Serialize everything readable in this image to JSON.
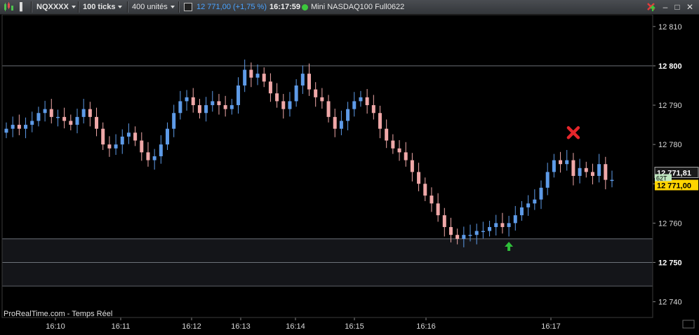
{
  "toolbar": {
    "symbol": "NQXXXX",
    "timeframe": "100 ticks",
    "units": "400 unités",
    "last_price": "12 771,00 (+1,75 %)",
    "time": "16:17:59",
    "instrument": "Mini NASDAQ100 Full0622",
    "status_color": "#3cc83c"
  },
  "watermark": "ProRealTime.com - Temps Réel",
  "price_labels": {
    "current": "12 771,81",
    "last": "12 771,00",
    "tick_badge": "62T"
  },
  "colors": {
    "up": "#5e9be8",
    "down": "#f0a8a8",
    "price_box": "#ffd400",
    "grid_band": "#141519"
  },
  "chart_data": {
    "type": "candlestick",
    "y_axis": {
      "min": 12736,
      "max": 12813,
      "ticks": [
        12810,
        12800,
        12790,
        12780,
        12770,
        12760,
        12750,
        12740
      ],
      "bold_ticks": [
        12800,
        12750
      ]
    },
    "x_ticks": [
      "16:10",
      "16:11",
      "16:12",
      "16:13",
      "16:14",
      "16:15",
      "16:16",
      "16:17"
    ],
    "horizontal_lines": [
      12800,
      12756,
      12750,
      12744
    ],
    "markers": [
      {
        "type": "sell-cross",
        "near_price": 12783
      },
      {
        "type": "buy-arrow",
        "near_price": 12754
      }
    ],
    "closes": [
      12784,
      12785,
      12784,
      12785,
      12786,
      12788,
      12789,
      12787,
      12787,
      12786,
      12785,
      12787,
      12789,
      12787,
      12784,
      12780,
      12779,
      12780,
      12782,
      12783,
      12781,
      12778,
      12776,
      12777,
      12780,
      12784,
      12788,
      12791,
      12792,
      12790,
      12788,
      12790,
      12791,
      12790,
      12789,
      12790,
      12795,
      12799,
      12797,
      12798,
      12796,
      12793,
      12791,
      12789,
      12791,
      12795,
      12798,
      12794,
      12792,
      12791,
      12787,
      12784,
      12786,
      12789,
      12791,
      12792,
      12790,
      12788,
      12784,
      12781,
      12779,
      12778,
      12776,
      12773,
      12770,
      12767,
      12765,
      12762,
      12759,
      12757,
      12756,
      12757,
      12757,
      12758,
      12758,
      12759,
      12760,
      12759,
      12760,
      12762,
      12764,
      12765,
      12766,
      12769,
      12773,
      12776,
      12775,
      12776,
      12772,
      12774,
      12773,
      12772,
      12775,
      12771,
      12771
    ]
  }
}
